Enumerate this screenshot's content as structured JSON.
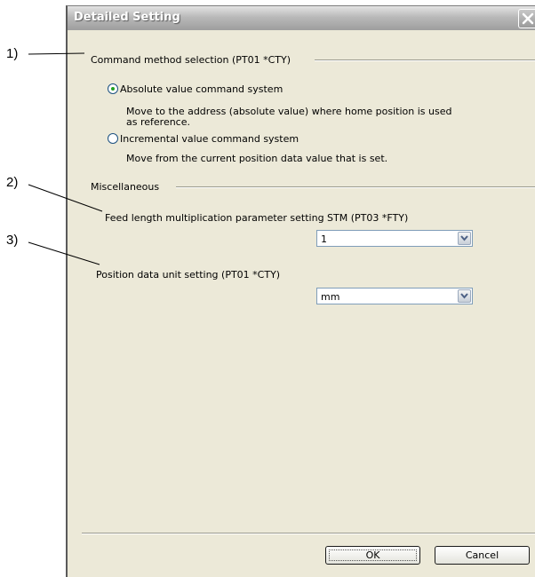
{
  "dialog": {
    "title": "Detailed Setting",
    "command_group": {
      "label": "Command method selection (PT01 *CTY)",
      "options": [
        {
          "label": "Absolute value command system",
          "selected": true,
          "desc_line1": "Move to the address (absolute value) where home position is used",
          "desc_line2": "as reference."
        },
        {
          "label": "Incremental value command system",
          "selected": false,
          "desc_line1": "Move from the current position data value that is set."
        }
      ]
    },
    "misc_group": {
      "label": "Miscellaneous",
      "feed_length": {
        "label": "Feed length multiplication parameter setting STM (PT03 *FTY)",
        "value": "1"
      },
      "position_unit": {
        "label": "Position data unit setting (PT01 *CTY)",
        "value": "mm"
      }
    },
    "buttons": {
      "ok": "OK",
      "cancel": "Cancel"
    }
  },
  "callouts": [
    "1)",
    "2)",
    "3)"
  ],
  "icons": {
    "close": "close-x-icon",
    "dropdown": "chevron-down-icon",
    "radio": "radio-button"
  }
}
